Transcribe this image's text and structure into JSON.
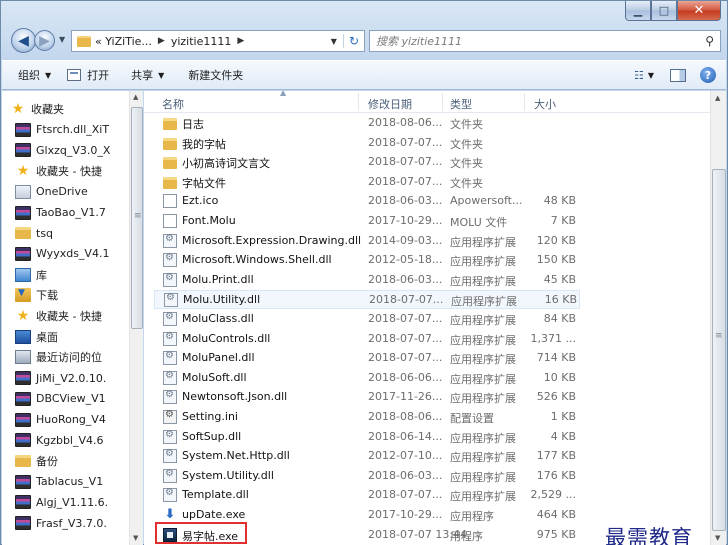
{
  "address": {
    "parts": [
      "« YiZiTie...",
      "yizitie1111"
    ]
  },
  "search": {
    "placeholder": "搜索 yizitie1111"
  },
  "toolbar": {
    "organize": "组织",
    "open": "打开",
    "share": "共享",
    "new_folder": "新建文件夹"
  },
  "sidebar": {
    "items": [
      {
        "label": "收藏夹",
        "icon": "star-icon"
      },
      {
        "label": "Ftsrch.dll_XiT",
        "icon": "winrar-icon"
      },
      {
        "label": "Glxzq_V3.0_X",
        "icon": "winrar-icon"
      },
      {
        "label": "收藏夹 - 快捷",
        "icon": "star-icon"
      },
      {
        "label": "OneDrive",
        "icon": "onedrive-icon"
      },
      {
        "label": "TaoBao_V1.7",
        "icon": "winrar-icon"
      },
      {
        "label": "tsq",
        "icon": "folder-icon"
      },
      {
        "label": "Wyyxds_V4.1",
        "icon": "winrar-icon"
      },
      {
        "label": "库",
        "icon": "library-icon"
      },
      {
        "label": "下载",
        "icon": "download-icon"
      },
      {
        "label": "收藏夹 - 快捷",
        "icon": "star-icon"
      },
      {
        "label": "桌面",
        "icon": "desktop-icon"
      },
      {
        "label": "最近访问的位",
        "icon": "recent-icon"
      },
      {
        "label": "JiMi_V2.0.10.",
        "icon": "winrar-icon"
      },
      {
        "label": "DBCView_V1",
        "icon": "winrar-icon"
      },
      {
        "label": "HuoRong_V4",
        "icon": "winrar-icon"
      },
      {
        "label": "Kgzbbl_V4.6",
        "icon": "winrar-icon"
      },
      {
        "label": "备份",
        "icon": "folder-icon"
      },
      {
        "label": "Tablacus_V1",
        "icon": "winrar-icon"
      },
      {
        "label": "Algj_V1.11.6.",
        "icon": "winrar-icon"
      },
      {
        "label": "Frasf_V3.7.0.",
        "icon": "winrar-icon"
      }
    ]
  },
  "columns": {
    "name": "名称",
    "date": "修改日期",
    "type": "类型",
    "size": "大小"
  },
  "files": [
    {
      "name": "日志",
      "date": "2018-08-06...",
      "type": "文件夹",
      "size": "",
      "icon": "folder"
    },
    {
      "name": "我的字帖",
      "date": "2018-07-07...",
      "type": "文件夹",
      "size": "",
      "icon": "folder"
    },
    {
      "name": "小初高诗词文言文",
      "date": "2018-07-07...",
      "type": "文件夹",
      "size": "",
      "icon": "folder"
    },
    {
      "name": "字帖文件",
      "date": "2018-07-07...",
      "type": "文件夹",
      "size": "",
      "icon": "folder"
    },
    {
      "name": "Ezt.ico",
      "date": "2018-06-03...",
      "type": "Apowersoft...",
      "size": "48 KB",
      "icon": "doc"
    },
    {
      "name": "Font.Molu",
      "date": "2017-10-29...",
      "type": "MOLU 文件",
      "size": "7 KB",
      "icon": "doc"
    },
    {
      "name": "Microsoft.Expression.Drawing.dll",
      "date": "2014-09-03...",
      "type": "应用程序扩展",
      "size": "120 KB",
      "icon": "dll"
    },
    {
      "name": "Microsoft.Windows.Shell.dll",
      "date": "2012-05-18...",
      "type": "应用程序扩展",
      "size": "150 KB",
      "icon": "dll"
    },
    {
      "name": "Molu.Print.dll",
      "date": "2018-06-03...",
      "type": "应用程序扩展",
      "size": "45 KB",
      "icon": "dll"
    },
    {
      "name": "Molu.Utility.dll",
      "date": "2018-07-07...",
      "type": "应用程序扩展",
      "size": "16 KB",
      "icon": "dll"
    },
    {
      "name": "MoluClass.dll",
      "date": "2018-07-07...",
      "type": "应用程序扩展",
      "size": "84 KB",
      "icon": "dll"
    },
    {
      "name": "MoluControls.dll",
      "date": "2018-07-07...",
      "type": "应用程序扩展",
      "size": "1,371 ...",
      "icon": "dll"
    },
    {
      "name": "MoluPanel.dll",
      "date": "2018-07-07...",
      "type": "应用程序扩展",
      "size": "714 KB",
      "icon": "dll"
    },
    {
      "name": "MoluSoft.dll",
      "date": "2018-06-06...",
      "type": "应用程序扩展",
      "size": "10 KB",
      "icon": "dll"
    },
    {
      "name": "Newtonsoft.Json.dll",
      "date": "2017-11-26...",
      "type": "应用程序扩展",
      "size": "526 KB",
      "icon": "dll"
    },
    {
      "name": "Setting.ini",
      "date": "2018-08-06...",
      "type": "配置设置",
      "size": "1 KB",
      "icon": "ini"
    },
    {
      "name": "SoftSup.dll",
      "date": "2018-06-14...",
      "type": "应用程序扩展",
      "size": "4 KB",
      "icon": "dll"
    },
    {
      "name": "System.Net.Http.dll",
      "date": "2012-07-10...",
      "type": "应用程序扩展",
      "size": "177 KB",
      "icon": "dll"
    },
    {
      "name": "System.Utility.dll",
      "date": "2018-06-03...",
      "type": "应用程序扩展",
      "size": "176 KB",
      "icon": "dll"
    },
    {
      "name": "Template.dll",
      "date": "2018-07-07...",
      "type": "应用程序扩展",
      "size": "2,529 ...",
      "icon": "dll"
    },
    {
      "name": "upDate.exe",
      "date": "2017-10-29...",
      "type": "应用程序",
      "size": "464 KB",
      "icon": "arrow"
    },
    {
      "name": "易字帖.exe",
      "date": "2018-07-07 13:44",
      "type": "用程序",
      "size": "975 KB",
      "icon": "exe"
    }
  ],
  "watermark": "最需教育"
}
